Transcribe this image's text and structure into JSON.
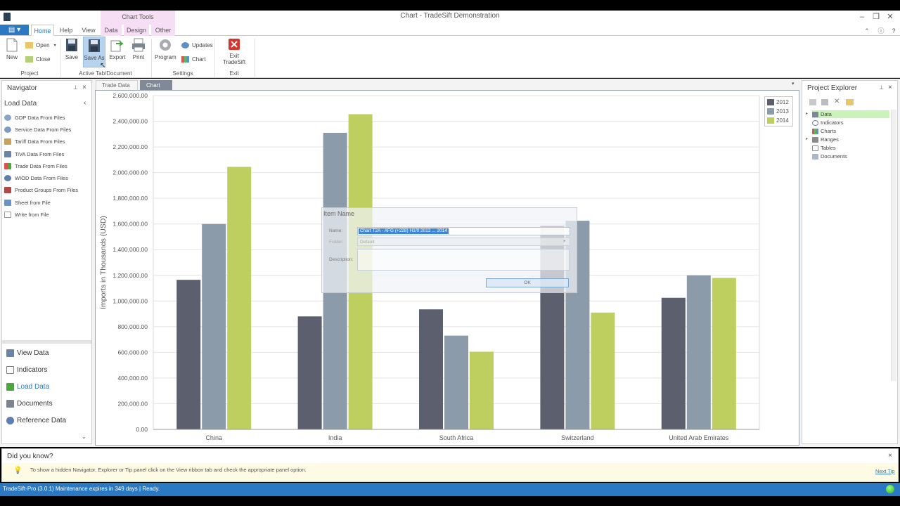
{
  "window": {
    "title": "Chart - TradeSift Demonstration",
    "context_tab_group": "Chart Tools"
  },
  "ribbon": {
    "tabs": [
      "Home",
      "Help",
      "View",
      "Data",
      "Design",
      "Other"
    ],
    "active_tab": "Home",
    "groups": {
      "project": {
        "label": "Project",
        "new": "New",
        "open": "Open",
        "close": "Close"
      },
      "active": {
        "label": "Active Tab/Document",
        "save": "Save",
        "save_as": "Save As",
        "export": "Export",
        "print": "Print"
      },
      "settings": {
        "label": "Settings",
        "program": "Program",
        "updates": "Updates",
        "chart": "Chart"
      },
      "exit": {
        "label": "Exit",
        "exit_app": "Exit TradeSift"
      }
    }
  },
  "navigator": {
    "title": "Navigator",
    "section": "Load Data",
    "items": [
      "GDP Data From Files",
      "Service Data From Files",
      "Tariff Data From Files",
      "TiVA Data From Files",
      "Trade Data From Files",
      "WIOD Data From Files",
      "Product Groups From Files",
      "Sheet from File",
      "Write from File"
    ],
    "bottom_items": [
      "View Data",
      "Indicators",
      "Load Data",
      "Documents",
      "Reference Data"
    ],
    "active_bottom": "Load Data"
  },
  "doc_tabs": [
    "Trade Data",
    "Chart"
  ],
  "active_doc_tab": "Chart",
  "chart_data": {
    "type": "bar",
    "categories": [
      "China",
      "India",
      "South Africa",
      "Switzerland",
      "United Arab Emirates"
    ],
    "series": [
      {
        "name": "2012",
        "color": "#5c5f6e",
        "values": [
          1165000,
          880000,
          935000,
          1585000,
          1025000
        ]
      },
      {
        "name": "2013",
        "color": "#8b9baa",
        "values": [
          1600000,
          2310000,
          730000,
          1625000,
          1200000
        ]
      },
      {
        "name": "2014",
        "color": "#bfcf5f",
        "values": [
          2045000,
          2455000,
          605000,
          910000,
          1180000
        ]
      }
    ],
    "ylabel": "Imports  in Thousands (USD)",
    "ylim": [
      0,
      2600000
    ],
    "yticks": [
      "0.00",
      "200,000.00",
      "400,000.00",
      "600,000.00",
      "800,000.00",
      "1,000,000.00",
      "1,200,000.00",
      "1,400,000.00",
      "1,600,000.00",
      "1,800,000.00",
      "2,000,000.00",
      "2,200,000.00",
      "2,400,000.00",
      "2,600,000.00"
    ],
    "grid": true,
    "legend": "top-right"
  },
  "dialog": {
    "title": "Item Name",
    "name_label": "Name:",
    "name_value": "Chart T2A - AFG (+228) H1/0 2012 ... 2014",
    "folder_label": "Folder:",
    "folder_value": "Default",
    "description_label": "Description:",
    "ok": "OK"
  },
  "explorer": {
    "title": "Project Explorer",
    "items": [
      "Data",
      "Indicators",
      "Charts",
      "Ranges",
      "Tables",
      "Documents"
    ],
    "selected": "Data"
  },
  "tips": {
    "title": "Did you know?",
    "text": "To show a hidden Navigator, Explorer or Tip panel click on the View ribbon tab and check the appropriate panel option.",
    "next": "Next Tip"
  },
  "status": {
    "text": "TradeSift-Pro (3.0.1) Maintenance expires in 349 days  |    Ready."
  }
}
